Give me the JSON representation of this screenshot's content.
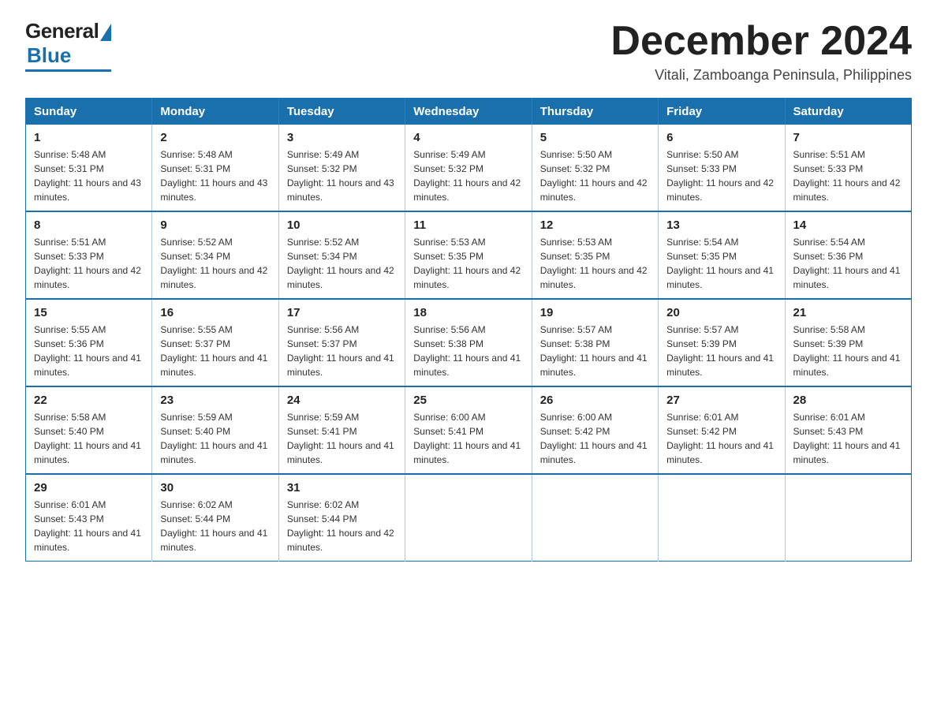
{
  "logo": {
    "general": "General",
    "blue": "Blue"
  },
  "header": {
    "title": "December 2024",
    "location": "Vitali, Zamboanga Peninsula, Philippines"
  },
  "days_of_week": [
    "Sunday",
    "Monday",
    "Tuesday",
    "Wednesday",
    "Thursday",
    "Friday",
    "Saturday"
  ],
  "weeks": [
    [
      {
        "day": "1",
        "sunrise": "5:48 AM",
        "sunset": "5:31 PM",
        "daylight": "11 hours and 43 minutes."
      },
      {
        "day": "2",
        "sunrise": "5:48 AM",
        "sunset": "5:31 PM",
        "daylight": "11 hours and 43 minutes."
      },
      {
        "day": "3",
        "sunrise": "5:49 AM",
        "sunset": "5:32 PM",
        "daylight": "11 hours and 43 minutes."
      },
      {
        "day": "4",
        "sunrise": "5:49 AM",
        "sunset": "5:32 PM",
        "daylight": "11 hours and 42 minutes."
      },
      {
        "day": "5",
        "sunrise": "5:50 AM",
        "sunset": "5:32 PM",
        "daylight": "11 hours and 42 minutes."
      },
      {
        "day": "6",
        "sunrise": "5:50 AM",
        "sunset": "5:33 PM",
        "daylight": "11 hours and 42 minutes."
      },
      {
        "day": "7",
        "sunrise": "5:51 AM",
        "sunset": "5:33 PM",
        "daylight": "11 hours and 42 minutes."
      }
    ],
    [
      {
        "day": "8",
        "sunrise": "5:51 AM",
        "sunset": "5:33 PM",
        "daylight": "11 hours and 42 minutes."
      },
      {
        "day": "9",
        "sunrise": "5:52 AM",
        "sunset": "5:34 PM",
        "daylight": "11 hours and 42 minutes."
      },
      {
        "day": "10",
        "sunrise": "5:52 AM",
        "sunset": "5:34 PM",
        "daylight": "11 hours and 42 minutes."
      },
      {
        "day": "11",
        "sunrise": "5:53 AM",
        "sunset": "5:35 PM",
        "daylight": "11 hours and 42 minutes."
      },
      {
        "day": "12",
        "sunrise": "5:53 AM",
        "sunset": "5:35 PM",
        "daylight": "11 hours and 42 minutes."
      },
      {
        "day": "13",
        "sunrise": "5:54 AM",
        "sunset": "5:35 PM",
        "daylight": "11 hours and 41 minutes."
      },
      {
        "day": "14",
        "sunrise": "5:54 AM",
        "sunset": "5:36 PM",
        "daylight": "11 hours and 41 minutes."
      }
    ],
    [
      {
        "day": "15",
        "sunrise": "5:55 AM",
        "sunset": "5:36 PM",
        "daylight": "11 hours and 41 minutes."
      },
      {
        "day": "16",
        "sunrise": "5:55 AM",
        "sunset": "5:37 PM",
        "daylight": "11 hours and 41 minutes."
      },
      {
        "day": "17",
        "sunrise": "5:56 AM",
        "sunset": "5:37 PM",
        "daylight": "11 hours and 41 minutes."
      },
      {
        "day": "18",
        "sunrise": "5:56 AM",
        "sunset": "5:38 PM",
        "daylight": "11 hours and 41 minutes."
      },
      {
        "day": "19",
        "sunrise": "5:57 AM",
        "sunset": "5:38 PM",
        "daylight": "11 hours and 41 minutes."
      },
      {
        "day": "20",
        "sunrise": "5:57 AM",
        "sunset": "5:39 PM",
        "daylight": "11 hours and 41 minutes."
      },
      {
        "day": "21",
        "sunrise": "5:58 AM",
        "sunset": "5:39 PM",
        "daylight": "11 hours and 41 minutes."
      }
    ],
    [
      {
        "day": "22",
        "sunrise": "5:58 AM",
        "sunset": "5:40 PM",
        "daylight": "11 hours and 41 minutes."
      },
      {
        "day": "23",
        "sunrise": "5:59 AM",
        "sunset": "5:40 PM",
        "daylight": "11 hours and 41 minutes."
      },
      {
        "day": "24",
        "sunrise": "5:59 AM",
        "sunset": "5:41 PM",
        "daylight": "11 hours and 41 minutes."
      },
      {
        "day": "25",
        "sunrise": "6:00 AM",
        "sunset": "5:41 PM",
        "daylight": "11 hours and 41 minutes."
      },
      {
        "day": "26",
        "sunrise": "6:00 AM",
        "sunset": "5:42 PM",
        "daylight": "11 hours and 41 minutes."
      },
      {
        "day": "27",
        "sunrise": "6:01 AM",
        "sunset": "5:42 PM",
        "daylight": "11 hours and 41 minutes."
      },
      {
        "day": "28",
        "sunrise": "6:01 AM",
        "sunset": "5:43 PM",
        "daylight": "11 hours and 41 minutes."
      }
    ],
    [
      {
        "day": "29",
        "sunrise": "6:01 AM",
        "sunset": "5:43 PM",
        "daylight": "11 hours and 41 minutes."
      },
      {
        "day": "30",
        "sunrise": "6:02 AM",
        "sunset": "5:44 PM",
        "daylight": "11 hours and 41 minutes."
      },
      {
        "day": "31",
        "sunrise": "6:02 AM",
        "sunset": "5:44 PM",
        "daylight": "11 hours and 42 minutes."
      },
      null,
      null,
      null,
      null
    ]
  ]
}
